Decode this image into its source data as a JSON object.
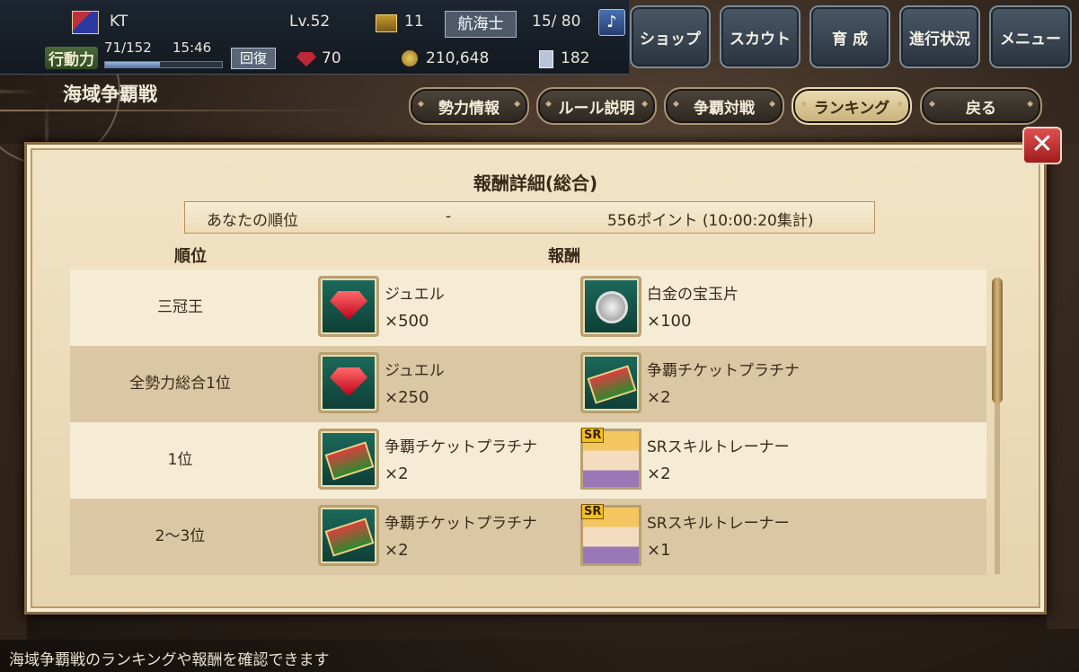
{
  "topbar": {
    "player_name": "KT",
    "level": "Lv.52",
    "chest_count": "11",
    "job": "航海士",
    "crew": "15/ 80",
    "stamina_label": "行動力",
    "stamina_value": "71/152",
    "stamina_fraction": 0.47,
    "stamina_timer": "15:46",
    "recover_label": "回復",
    "gems": "70",
    "coins": "210,648",
    "cards": "182",
    "note_icon": "♪"
  },
  "menu": [
    "ショップ",
    "スカウト",
    "育 成",
    "進行状況",
    "メニュー"
  ],
  "section": {
    "title": "海域争覇戦"
  },
  "nav": {
    "items": [
      "勢力情報",
      "ルール説明",
      "争覇対戦",
      "ランキング",
      "戻る"
    ],
    "active_index": 3
  },
  "panel": {
    "title": "報酬詳細(総合)",
    "your_rank_label": "あなたの順位",
    "your_rank_value": "-",
    "your_points": "556ポイント (10:00:20集計)",
    "col_rank": "順位",
    "col_reward": "報酬",
    "close_symbol": "✕"
  },
  "rows": [
    {
      "rank": "三冠王",
      "r1": {
        "icon": "jewel-icon",
        "name": "ジュエル",
        "qty": "×500"
      },
      "r2": {
        "icon": "platinum-gem-fragment-icon",
        "name": "白金の宝玉片",
        "qty": "×100"
      }
    },
    {
      "rank": "全勢力総合1位",
      "r1": {
        "icon": "jewel-icon",
        "name": "ジュエル",
        "qty": "×250"
      },
      "r2": {
        "icon": "ticket-icon",
        "name": "争覇チケットプラチナ",
        "qty": "×2"
      }
    },
    {
      "rank": "1位",
      "r1": {
        "icon": "ticket-icon",
        "name": "争覇チケットプラチナ",
        "qty": "×2"
      },
      "r2": {
        "icon": "sr-trainer-portrait-icon",
        "badge": "SR",
        "name": "SRスキルトレーナー",
        "qty": "×2"
      }
    },
    {
      "rank": "2～3位",
      "r1": {
        "icon": "ticket-icon",
        "name": "争覇チケットプラチナ",
        "qty": "×2"
      },
      "r2": {
        "icon": "sr-trainer-portrait-icon",
        "badge": "SR",
        "name": "SRスキルトレーナー",
        "qty": "×1"
      }
    }
  ],
  "hint": {
    "text": "海域争覇戦のランキングや報酬を確認できます"
  }
}
